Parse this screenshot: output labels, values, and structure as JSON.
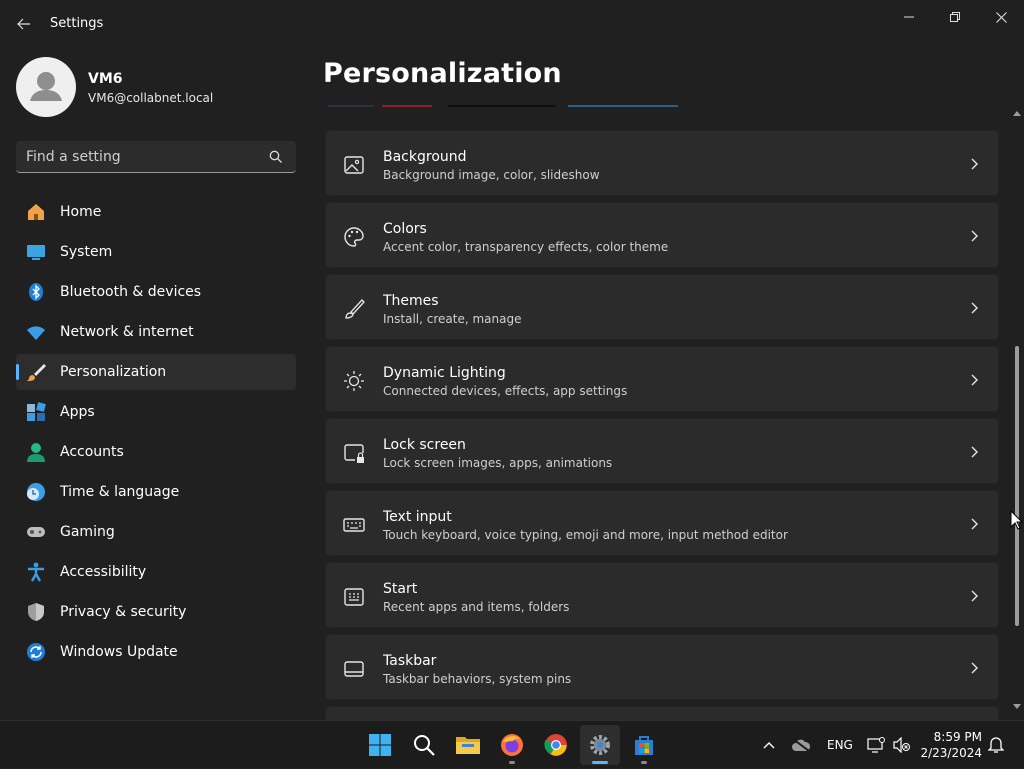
{
  "window": {
    "title": "Settings"
  },
  "profile": {
    "name": "VM6",
    "email": "VM6@collabnet.local"
  },
  "search": {
    "placeholder": "Find a setting"
  },
  "nav": {
    "items": [
      {
        "label": "Home",
        "icon": "home-icon"
      },
      {
        "label": "System",
        "icon": "system-icon"
      },
      {
        "label": "Bluetooth & devices",
        "icon": "bluetooth-icon"
      },
      {
        "label": "Network & internet",
        "icon": "network-icon"
      },
      {
        "label": "Personalization",
        "icon": "paintbrush-icon",
        "selected": true
      },
      {
        "label": "Apps",
        "icon": "apps-icon"
      },
      {
        "label": "Accounts",
        "icon": "accounts-icon"
      },
      {
        "label": "Time & language",
        "icon": "clock-globe-icon"
      },
      {
        "label": "Gaming",
        "icon": "gamepad-icon"
      },
      {
        "label": "Accessibility",
        "icon": "accessibility-icon"
      },
      {
        "label": "Privacy & security",
        "icon": "shield-icon"
      },
      {
        "label": "Windows Update",
        "icon": "update-icon"
      }
    ]
  },
  "main": {
    "title": "Personalization",
    "cards": [
      {
        "title": "Background",
        "desc": "Background image, color, slideshow",
        "icon": "picture-icon"
      },
      {
        "title": "Colors",
        "desc": "Accent color, transparency effects, color theme",
        "icon": "palette-icon"
      },
      {
        "title": "Themes",
        "desc": "Install, create, manage",
        "icon": "brush-icon"
      },
      {
        "title": "Dynamic Lighting",
        "desc": "Connected devices, effects, app settings",
        "icon": "lighting-icon"
      },
      {
        "title": "Lock screen",
        "desc": "Lock screen images, apps, animations",
        "icon": "lock-screen-icon"
      },
      {
        "title": "Text input",
        "desc": "Touch keyboard, voice typing, emoji and more, input method editor",
        "icon": "keyboard-icon"
      },
      {
        "title": "Start",
        "desc": "Recent apps and items, folders",
        "icon": "start-icon"
      },
      {
        "title": "Taskbar",
        "desc": "Taskbar behaviors, system pins",
        "icon": "taskbar-icon"
      }
    ]
  },
  "taskbar": {
    "apps": [
      "windows-start-icon",
      "search-icon",
      "file-explorer-icon",
      "firefox-icon",
      "chrome-icon",
      "settings-gear-icon",
      "microsoft-store-icon"
    ],
    "language": "ENG",
    "time": "8:59 PM",
    "date": "2/23/2024"
  },
  "colors": {
    "accent": "#5ab4ff",
    "background": "#202020",
    "card": "#2b2b2b",
    "taskbar": "#1c1c1c"
  }
}
